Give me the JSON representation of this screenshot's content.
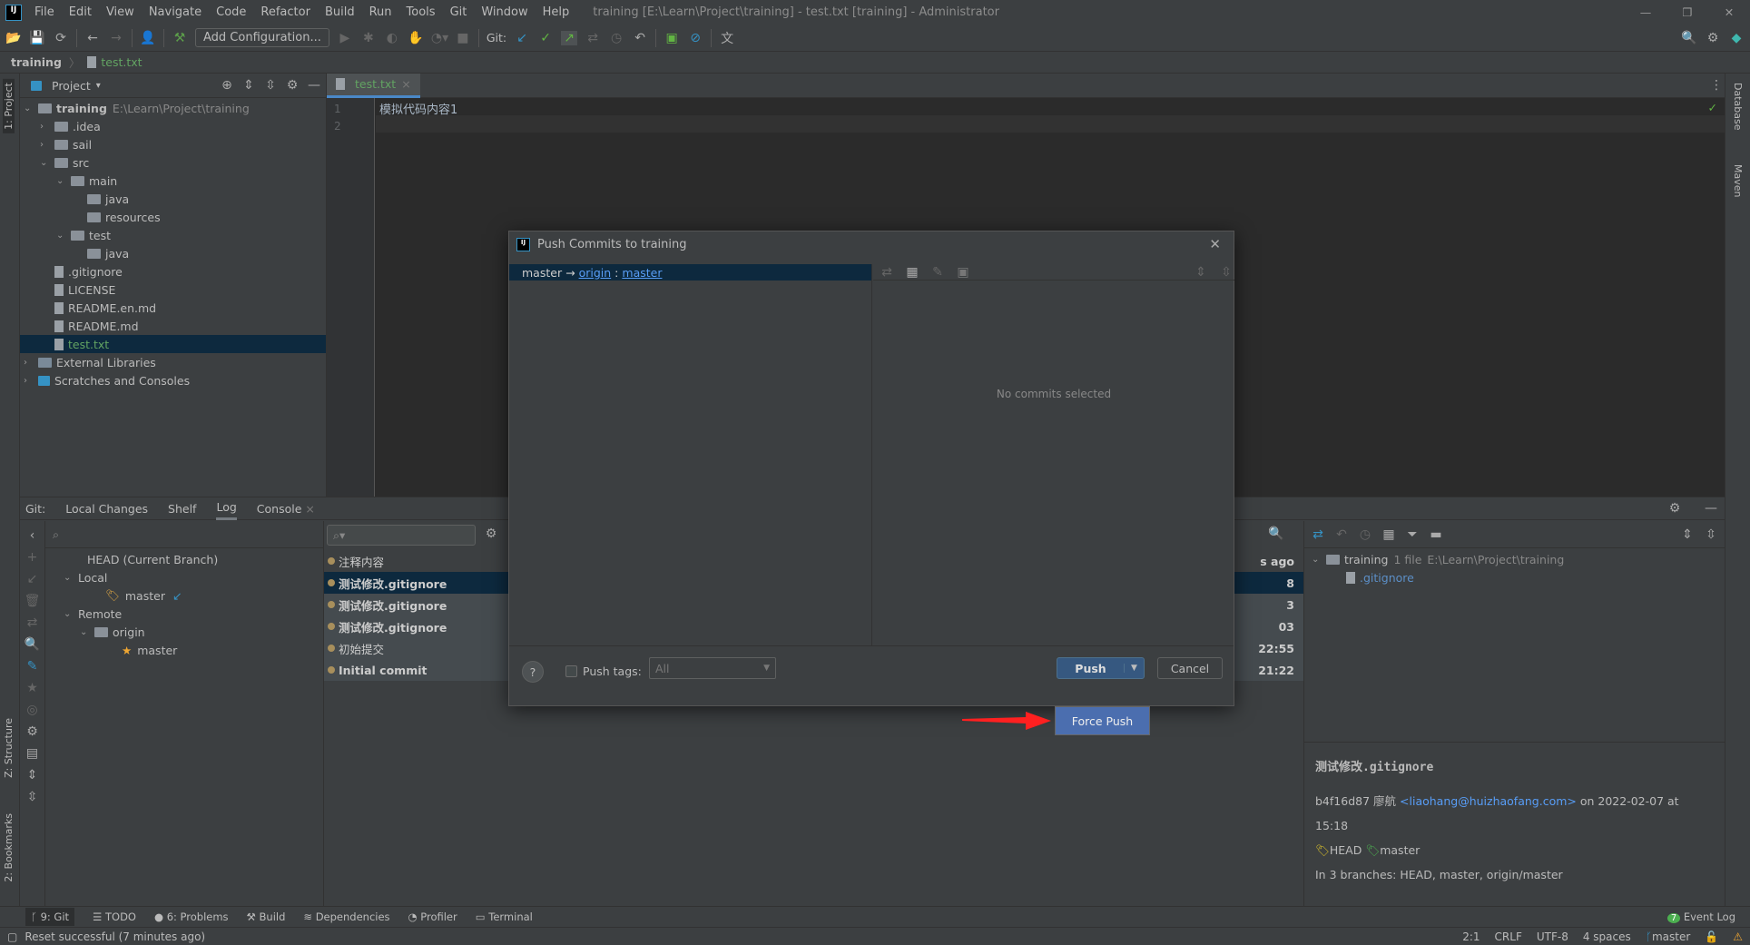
{
  "app": {
    "title": "training [E:\\Learn\\Project\\training] - test.txt [training] - Administrator",
    "logo": "IJ"
  },
  "menu": [
    "File",
    "Edit",
    "View",
    "Navigate",
    "Code",
    "Refactor",
    "Build",
    "Run",
    "Tools",
    "Git",
    "Window",
    "Help"
  ],
  "toolbar": {
    "add_config": "Add Configuration...",
    "git_label": "Git:"
  },
  "breadcrumb": {
    "project": "training",
    "file": "test.txt"
  },
  "left_stripe": {
    "project": "1: Project",
    "structure": "Z: Structure",
    "bookmarks": "2: Bookmarks"
  },
  "right_stripe": {
    "database": "Database",
    "maven": "Maven"
  },
  "project_panel": {
    "title": "Project",
    "tree": [
      {
        "label": "training",
        "hint": "E:\\Learn\\Project\\training",
        "depth": 0,
        "type": "root",
        "open": true
      },
      {
        "label": ".idea",
        "depth": 1,
        "type": "folder",
        "open": false
      },
      {
        "label": "sail",
        "depth": 1,
        "type": "folder",
        "open": false
      },
      {
        "label": "src",
        "depth": 1,
        "type": "folder",
        "open": true
      },
      {
        "label": "main",
        "depth": 2,
        "type": "folder",
        "open": true
      },
      {
        "label": "java",
        "depth": 3,
        "type": "folder"
      },
      {
        "label": "resources",
        "depth": 3,
        "type": "folder"
      },
      {
        "label": "test",
        "depth": 2,
        "type": "folder",
        "open": true
      },
      {
        "label": "java",
        "depth": 3,
        "type": "folder"
      },
      {
        "label": ".gitignore",
        "depth": 1,
        "type": "file"
      },
      {
        "label": "LICENSE",
        "depth": 1,
        "type": "file"
      },
      {
        "label": "README.en.md",
        "depth": 1,
        "type": "file"
      },
      {
        "label": "README.md",
        "depth": 1,
        "type": "file"
      },
      {
        "label": "test.txt",
        "depth": 1,
        "type": "file",
        "selected": true
      },
      {
        "label": "External Libraries",
        "depth": 0,
        "type": "lib",
        "open": false
      },
      {
        "label": "Scratches and Consoles",
        "depth": 0,
        "type": "scratch",
        "open": false
      }
    ]
  },
  "editor": {
    "tab": "test.txt",
    "lines": [
      "1",
      "2"
    ],
    "code": "模拟代码内容1"
  },
  "git_panel": {
    "prefix": "Git:",
    "tabs": [
      "Local Changes",
      "Shelf",
      "Log",
      "Console"
    ],
    "active_tab": "Log",
    "branches": {
      "head": "HEAD (Current Branch)",
      "local": "Local",
      "local_master": "master",
      "remote": "Remote",
      "origin": "origin",
      "origin_master": "master"
    },
    "commits": [
      {
        "msg": "注释内容",
        "time": "s ago"
      },
      {
        "msg": "测试修改.gitignore",
        "time": "8",
        "selected": true
      },
      {
        "msg": "测试修改.gitignore",
        "time": "3"
      },
      {
        "msg": "测试修改.gitignore",
        "time": "03"
      },
      {
        "msg": "初始提交",
        "time": "22:55"
      },
      {
        "msg": "Initial commit",
        "time": "21:22"
      }
    ],
    "changes": {
      "root": "training",
      "count": "1 file",
      "path": "E:\\Learn\\Project\\training",
      "file": ".gitignore"
    },
    "detail": {
      "title": "测试修改.gitignore",
      "hash": "b4f16d87",
      "author": "廖航",
      "email": "<liaohang@huizhaofang.com>",
      "date": "on 2022-02-07 at 15:18",
      "tag_head": "HEAD",
      "tag_master": "master",
      "branches": "In 3 branches: HEAD, master, origin/master"
    }
  },
  "dialog": {
    "title": "Push Commits to training",
    "local": "master",
    "arrow": "→",
    "remote": "origin",
    "sep": ":",
    "remote_branch": "master",
    "empty": "No commits selected",
    "help": "?",
    "push_tags": "Push tags:",
    "tags_value": "All",
    "push": "Push",
    "cancel": "Cancel",
    "force_push": "Force Push"
  },
  "tool_windows": [
    "9: Git",
    "TODO",
    "6: Problems",
    "Build",
    "Dependencies",
    "Profiler",
    "Terminal"
  ],
  "event_log": {
    "count": "7",
    "label": "Event Log"
  },
  "status": {
    "message": "Reset successful (7 minutes ago)",
    "pos": "2:1",
    "eol": "CRLF",
    "enc": "UTF-8",
    "indent": "4 spaces",
    "branch": "master"
  },
  "colors": {
    "accent": "#4a88c7",
    "selection": "#0d293e",
    "force_push": "#4b6eaf",
    "arrow": "#ff2020"
  }
}
